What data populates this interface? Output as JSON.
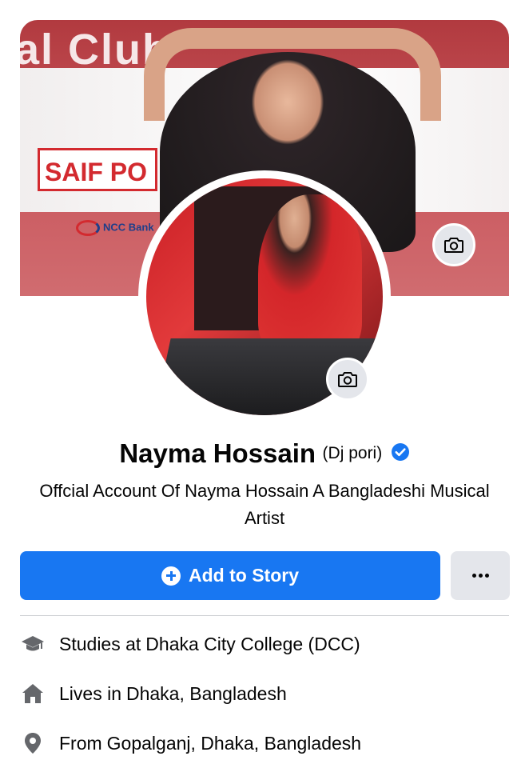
{
  "cover": {
    "club_text": "al Club",
    "sponsor_saif": "SAIF PO",
    "sponsor_ncc": "NCC Bank"
  },
  "profile": {
    "name": "Nayma Hossain",
    "nickname": "(Dj pori)",
    "verified": true,
    "bio": "Offcial Account Of Nayma Hossain A Bangladeshi Musical Artist"
  },
  "actions": {
    "add_story_label": "Add to Story",
    "more_label": "..."
  },
  "details": [
    {
      "icon": "graduation-cap-icon",
      "prefix": "Studies at",
      "value": "Dhaka City College (DCC)"
    },
    {
      "icon": "home-icon",
      "prefix": "Lives in",
      "value": "Dhaka, Bangladesh"
    },
    {
      "icon": "location-pin-icon",
      "prefix": "From",
      "value": "Gopalganj, Dhaka, Bangladesh"
    }
  ],
  "colors": {
    "primary": "#1877f2",
    "secondary_button": "#e4e6eb",
    "icon_gray": "#65676b"
  }
}
